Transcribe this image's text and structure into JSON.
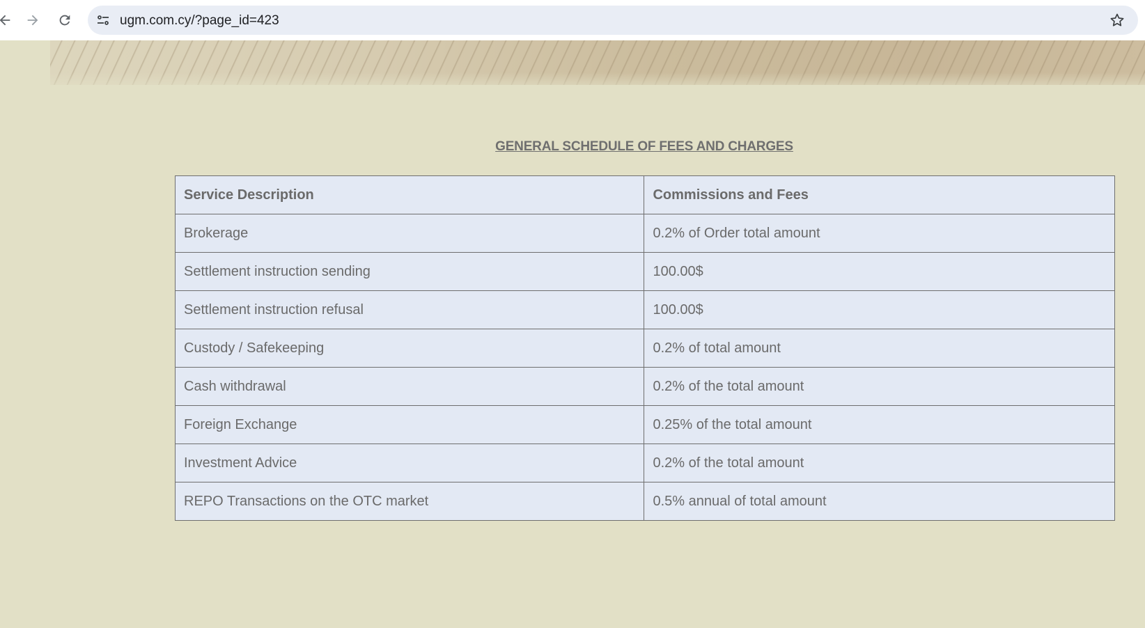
{
  "browser": {
    "url": "ugm.com.cy/?page_id=423",
    "icons": {
      "back": "back-arrow-icon",
      "forward": "forward-arrow-icon",
      "reload": "reload-icon",
      "site_info": "site-info-icon",
      "bookmark": "star-icon"
    }
  },
  "page": {
    "title": "GENERAL SCHEDULE OF FEES AND CHARGES"
  },
  "table": {
    "headers": [
      "Service Description",
      "Commissions and Fees"
    ],
    "rows": [
      [
        "Brokerage",
        "0.2% of Order total amount"
      ],
      [
        "Settlement instruction sending",
        "100.00$"
      ],
      [
        "Settlement instruction refusal",
        "100.00$"
      ],
      [
        "Custody / Safekeeping",
        "0.2% of total amount"
      ],
      [
        "Cash withdrawal",
        "0.2% of the total amount"
      ],
      [
        "Foreign Exchange",
        "0.25% of the total amount"
      ],
      [
        "Investment Advice",
        "0.2% of the total amount"
      ],
      [
        "REPO Transactions on the OTC market",
        "0.5% annual of total amount"
      ]
    ]
  },
  "colors": {
    "page_background": "#e2e0c6",
    "table_background": "#e3e9f4",
    "text": "#6a6a6a",
    "border": "#6e6e6e"
  }
}
